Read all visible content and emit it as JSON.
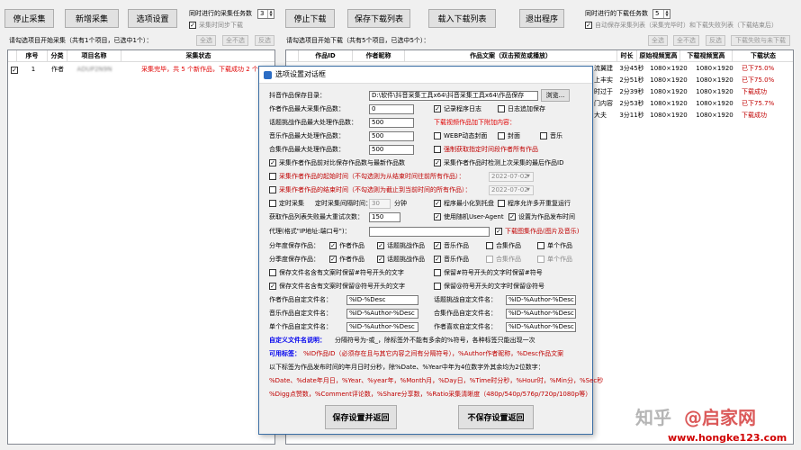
{
  "toolbar_left": {
    "stop_collect": "停止采集",
    "add_collect": "新增采集",
    "options": "选项设置",
    "concurrent_collect_label": "同时进行的采集任务数",
    "concurrent_collect_value": "3",
    "sync_download_label": "采集时同步下载"
  },
  "toolbar_right": {
    "stop_download": "停止下载",
    "save_list": "保存下载列表",
    "load_list": "载入下载列表",
    "exit": "退出程序",
    "concurrent_download_label": "同时进行的下载任务数",
    "concurrent_download_value": "5",
    "auto_save_label": "自动保存采集列表（采集完毕时）和下载失败列表（下载结束后）"
  },
  "left_panel": {
    "hint": "请勾选项目开始采集（共有1个项目，已选中1个）：",
    "select_all": "全选",
    "select_none": "全不选",
    "invert": "反选",
    "columns": [
      "序号",
      "分类",
      "项目名称",
      "采集状态"
    ],
    "rows": [
      {
        "index": "1",
        "category": "作者",
        "name": "ADUP2N9N",
        "status": "采集完毕，共 5 个新作品，下载成功 2 个"
      }
    ]
  },
  "right_panel": {
    "hint": "请勾选项目开始下载（共有5个项目，已选中5个）：",
    "select_all": "全选",
    "select_none": "全不选",
    "invert": "反选",
    "down_failed": "下载失败与未下载",
    "columns": [
      "作品ID",
      "作者昵称",
      "作品文案（双击预览或播放）",
      "时长",
      "原始视频宽高",
      "下载视频宽高",
      "下载状态"
    ],
    "rows": [
      {
        "caption_tail": "流翼建",
        "duration": "3分45秒",
        "orig": "1080×1920",
        "down": "1080×1920",
        "status": "已下75.0%"
      },
      {
        "caption_tail": "上丰实",
        "duration": "2分51秒",
        "orig": "1080×1920",
        "down": "1080×1920",
        "status": "已下75.0%"
      },
      {
        "caption_tail": "时过于",
        "duration": "2分39秒",
        "orig": "1080×1920",
        "down": "1080×1920",
        "status": "下载成功"
      },
      {
        "caption_tail": "门内容",
        "duration": "2分53秒",
        "orig": "1080×1920",
        "down": "1080×1920",
        "status": "已下75.7%"
      },
      {
        "caption_tail": "大夫",
        "duration": "3分11秒",
        "orig": "1080×1920",
        "down": "1080×1920",
        "status": "下载成功"
      }
    ]
  },
  "dialog": {
    "title": "选项设置对话框",
    "save_dir_label": "抖音作品保存目录：",
    "save_dir_value": "D:\\软件\\抖音采集工具x64\\抖音采集工具x64\\作品保存",
    "browse": "浏览...",
    "max_author_label": "作者作品最大采集作品数：",
    "max_author_value": "0",
    "max_topic_label": "话题挑战作品最大处理作品数：",
    "max_topic_value": "500",
    "max_music_label": "音乐作品最大处理作品数：",
    "max_music_value": "500",
    "max_collection_label": "合集作品最大处理作品数：",
    "max_collection_value": "500",
    "record_log": "记录程序日志",
    "log_append": "日志追加保存",
    "extra_content_label": "下载视频作品加下附加内容：",
    "webp_cover": "WEBP动态封面",
    "cover": "封面",
    "music": "音乐",
    "force_range": "强制获取指定时间段作者所有作品",
    "compare_new": "采集作者作品前对比保存作品数与最新作品数",
    "check_last": "采集作者作品时检测上次采集的最后作品ID",
    "start_time_label": "采集作者作品的起始时间（不勾选则为从结束时间往前所有作品）：",
    "start_time_value": "2022-07-02",
    "end_time_label": "采集作者作品的结束时间（不勾选则为截止到当前时间的所有作品）：",
    "end_time_value": "2022-07-02",
    "timed_collect": "定时采集",
    "timed_interval_label": "定时采集间隔时间：",
    "timed_interval_value": "30",
    "minutes": "分钟",
    "minimize_tray": "程序最小化到托盘",
    "multi_instance": "程序允许多开重复运行",
    "max_retry_label": "获取作品列表失败最大重试次数：",
    "max_retry_value": "150",
    "random_ua": "使用随机User-Agent",
    "set_publish_time": "设置为作品发布时间",
    "proxy_label": "代理(格式\"IP地址:端口号\")：",
    "proxy_value": "",
    "download_images": "下载图集作品(图片及音乐)",
    "cat_save_label": "分年度保存作品：",
    "cat2_save_label": "分季度保存作品：",
    "cat_author": "作者作品",
    "cat_topic": "话题挑战作品",
    "cat_music": "音乐作品",
    "cat_collection": "合集作品",
    "cat_single": "单个作品",
    "keep_text_a": "保存文件名含有文案时保留#符号开头的文字",
    "keep_text_b": "保留#符号开头的文字时保留#符号",
    "keep_text_c": "保存文件名含有文案时保留@符号开头的文字",
    "keep_text_d": "保留@符号开头的文字时保留@符号",
    "author_name_label": "作者作品自定文件名：",
    "author_name_value": "%ID-%Desc",
    "topic_name_label": "话题挑战自定文件名：",
    "topic_name_value": "%ID-%Author-%Desc",
    "music_name_label": "音乐作品自定文件名：",
    "music_name_value": "%ID-%Author-%Desc",
    "collection_name_label": "合集作品自定文件名：",
    "collection_name_value": "%ID-%Author-%Desc",
    "single_name_label": "单个作品自定文件名：",
    "single_name_value": "%ID-%Author-%Desc",
    "liked_name_label": "作者喜欢自定文件名：",
    "liked_name_value": "%ID-%Author-%Desc",
    "custom_note_head": "自定义文件名说明：",
    "custom_note_text": "分隔符号为-或_，除标签外不能有多余的%符号，各种标签只能出现一次",
    "tags_head": "可用标签：",
    "tags_line1": "%ID作品ID（必须存在且与其它内容之间有分隔符号），%Author作者昵称，%Desc作品文案",
    "tags_line2": "以下标签为作品发布时间的年月日时分秒，除%Date、%Year中年为4位数字外其余均为2位数字：",
    "tags_line3": "%Date、%date年月日，%Year、%year年，%Month月，%Day日，%Time时分秒，%Hour时，%Min分，%Sec秒",
    "tags_line4": "%Digg点赞数，%Comment评论数，%Share分享数，%Ratio采集清晰度（480p/540p/576p/720p/1080p等）",
    "save_button": "保存设置并返回",
    "cancel_button": "不保存设置返回"
  },
  "watermark": {
    "zhihu": "知乎",
    "brand": "@启家网",
    "url": "www.hongke123.com"
  }
}
